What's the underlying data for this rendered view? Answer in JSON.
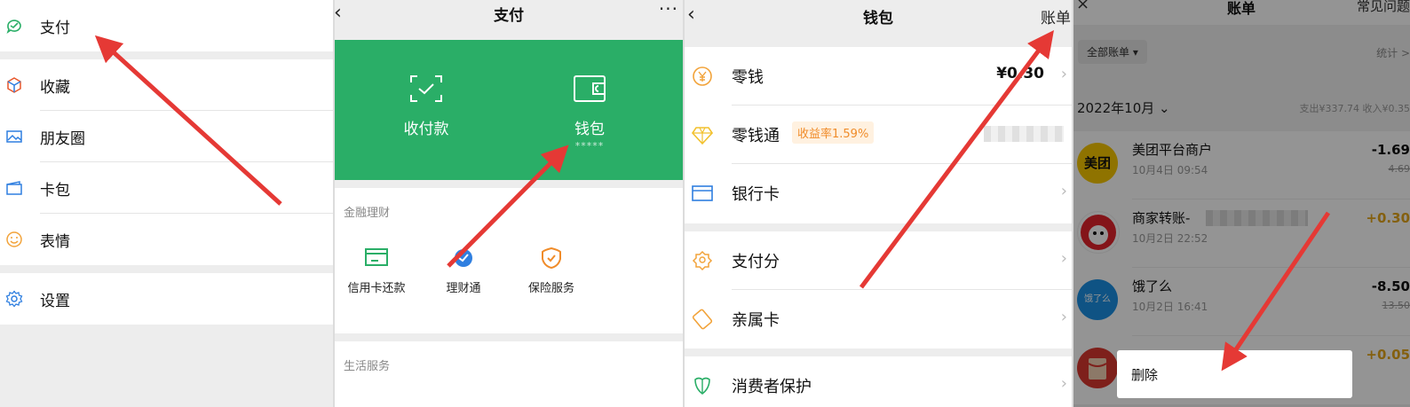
{
  "panel1": {
    "items": [
      {
        "label": "支付",
        "icon": "pay-icon"
      },
      {
        "label": "收藏",
        "icon": "favorites-icon"
      },
      {
        "label": "朋友圈",
        "icon": "moments-icon"
      },
      {
        "label": "卡包",
        "icon": "card-wallet-icon"
      },
      {
        "label": "表情",
        "icon": "sticker-icon"
      },
      {
        "label": "设置",
        "icon": "settings-icon"
      }
    ]
  },
  "panel2": {
    "title": "支付",
    "more": "···",
    "collect": {
      "label": "收付款",
      "icon": "scan-pay-icon"
    },
    "wallet": {
      "label": "钱包",
      "sub": "*****",
      "icon": "wallet-icon"
    },
    "finance_section": "金融理财",
    "services": [
      {
        "label": "信用卡还款",
        "icon": "credit-card-icon"
      },
      {
        "label": "理财通",
        "icon": "licaitong-icon"
      },
      {
        "label": "保险服务",
        "icon": "insurance-icon"
      }
    ],
    "life_section": "生活服务"
  },
  "panel3": {
    "title": "钱包",
    "bills_link": "账单",
    "items": [
      {
        "label": "零钱",
        "value": "¥0.30",
        "icon": "change-icon"
      },
      {
        "label": "零钱通",
        "badge": "收益率1.59%",
        "icon": "diamond-icon"
      },
      {
        "label": "银行卡",
        "icon": "bank-card-icon"
      },
      {
        "label": "支付分",
        "icon": "pay-score-icon"
      },
      {
        "label": "亲属卡",
        "icon": "family-card-icon"
      },
      {
        "label": "消费者保护",
        "icon": "consumer-protection-icon"
      }
    ]
  },
  "panel4": {
    "title": "账单",
    "faq": "常见问题",
    "all_bills": "全部账单 ▾",
    "stats": "统计 >",
    "month": "2022年10月 ⌄",
    "month_totals": "支出¥337.74  收入¥0.35",
    "transactions": [
      {
        "name": "美团平台商户",
        "time": "10月4日 09:54",
        "amount": "-1.69",
        "original": "4.69",
        "avatar": "美团"
      },
      {
        "name": "商家转账-",
        "time": "10月2日 22:52",
        "amount": "+0.30",
        "original": ""
      },
      {
        "name": "饿了么",
        "time": "10月2日 16:41",
        "amount": "-8.50",
        "original": "13.50",
        "avatar": "饿了么"
      },
      {
        "name": "",
        "time": "",
        "amount": "+0.05",
        "original": ""
      }
    ],
    "delete_label": "删除"
  },
  "colors": {
    "wechat_green": "#2aae67",
    "arrow_red": "#e53935",
    "badge_orange": "#f08c2a",
    "meituan_yellow": "#f7c600",
    "eleme_blue": "#1a8fe3"
  }
}
